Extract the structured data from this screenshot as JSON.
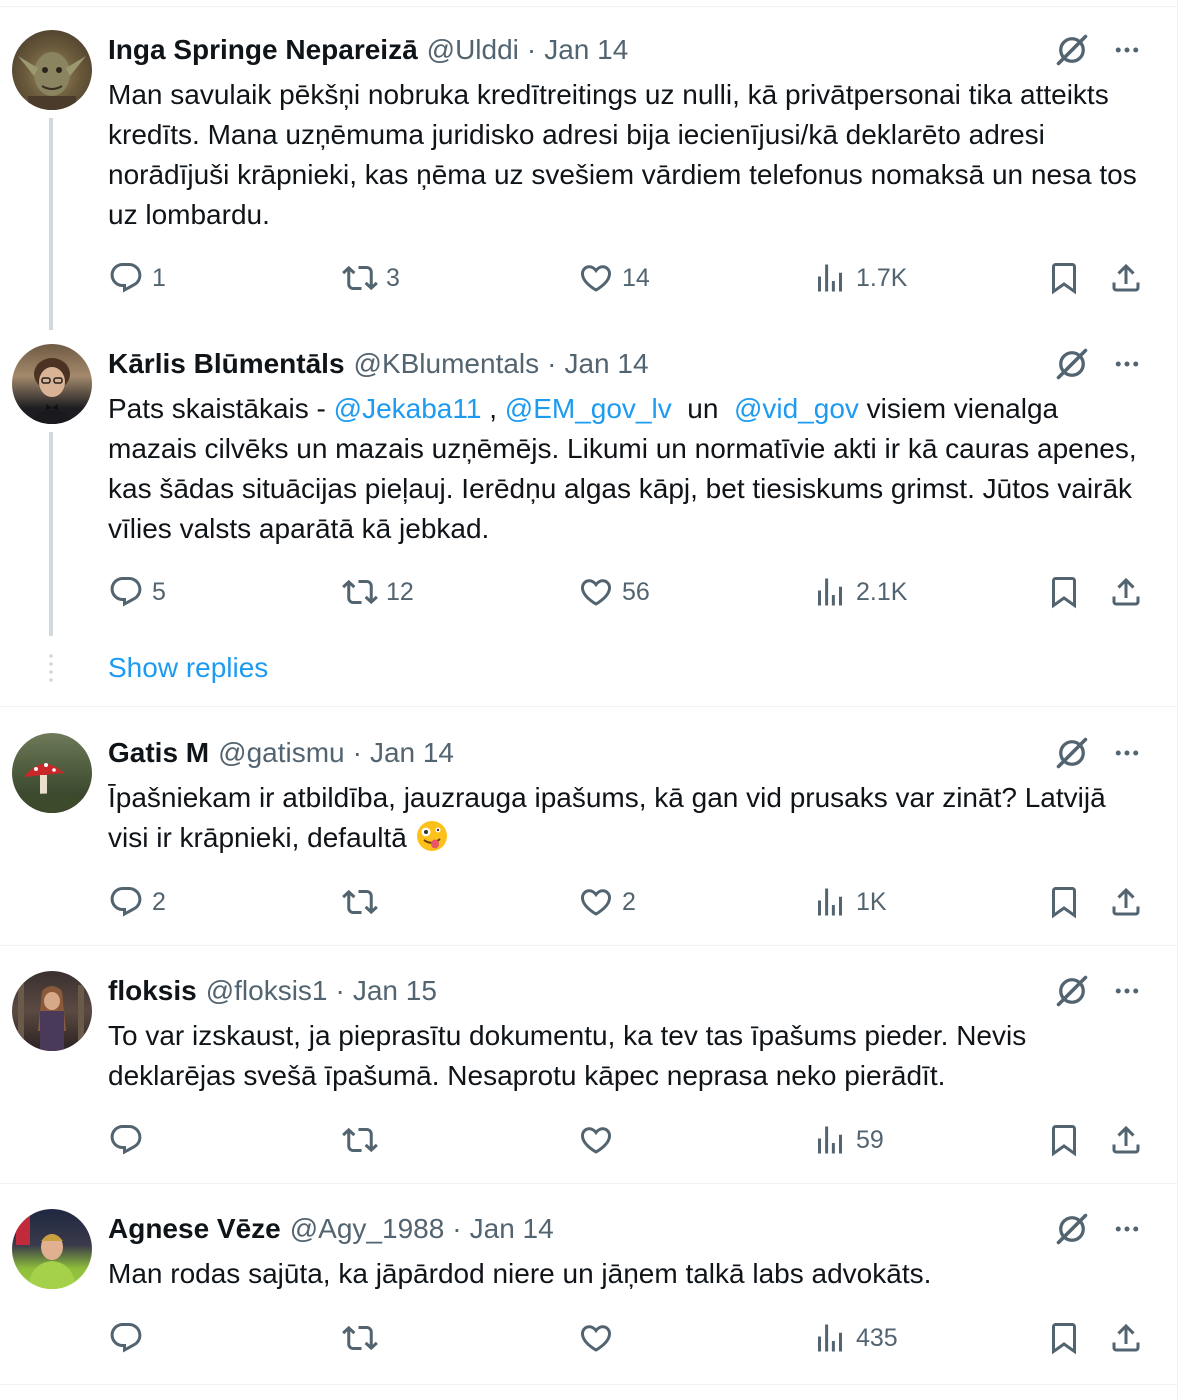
{
  "colors": {
    "accent": "#1d9bf0",
    "text": "#0f1419",
    "muted": "#536471",
    "line": "#cfd9de"
  },
  "posts": [
    {
      "name": "Inga Springe Nepareizā",
      "handle": "@Ulddi",
      "date": "Jan 14",
      "text": "Man savulaik pēkšņi nobruka kredītreitings uz nulli, kā privātpersonai tika atteikts kredīts.  Mana uzņēmuma juridisko adresi bija iecienījusi/kā deklarēto adresi norādījuši krāpnieki, kas ņēma uz svešiem vārdiem telefonus  nomaksā un nesa tos uz lombardu.",
      "replies": "1",
      "reposts": "3",
      "likes": "14",
      "views": "1.7K"
    },
    {
      "name": "Kārlis Blūmentāls",
      "handle": "@KBlumentals",
      "date": "Jan 14",
      "text_parts": {
        "t1": "Pats skaistākais - ",
        "m1": "@Jekaba11",
        "t2": " , ",
        "m2": "@EM_gov_lv",
        "t3": "  un  ",
        "m3": "@vid_gov",
        "t4": "  visiem vienalga mazais cilvēks un mazais uzņēmējs. Likumi un normatīvie akti ir kā cauras apenes, kas šādas situācijas pieļauj. Ierēdņu algas kāpj, bet tiesiskums grimst. Jūtos vairāk vīlies valsts aparātā kā jebkad."
      },
      "replies": "5",
      "reposts": "12",
      "likes": "56",
      "views": "2.1K",
      "show_replies": "Show replies"
    },
    {
      "name": "Gatis M",
      "handle": "@gatismu",
      "date": "Jan 14",
      "text": "Īpašniekam ir atbildība, jauzrauga ipašums, kā gan vid prusaks var zināt? Latvijā visi ir krāpnieki, defaultā ",
      "emoji": "zany-face-emoji",
      "replies": "2",
      "reposts": "",
      "likes": "2",
      "views": "1K"
    },
    {
      "name": "floksis",
      "handle": "@floksis1",
      "date": "Jan 15",
      "text": "To var izskaust, ja pieprasītu dokumentu, ka tev tas īpašums pieder. Nevis deklarējas svešā īpašumā. Nesaprotu kāpec neprasa neko pierādīt.",
      "replies": "",
      "reposts": "",
      "likes": "",
      "views": "59"
    },
    {
      "name": "Agnese Vēze",
      "handle": "@Agy_1988",
      "date": "Jan 14",
      "text": "Man rodas sajūta, ka jāpārdod niere un jāņem talkā labs advokāts.",
      "replies": "",
      "reposts": "",
      "likes": "",
      "views": "435"
    }
  ],
  "header_separator": "·",
  "icons": [
    "reply-icon",
    "repost-icon",
    "like-icon",
    "views-icon",
    "bookmark-icon",
    "share-icon",
    "grok-icon",
    "more-icon"
  ]
}
